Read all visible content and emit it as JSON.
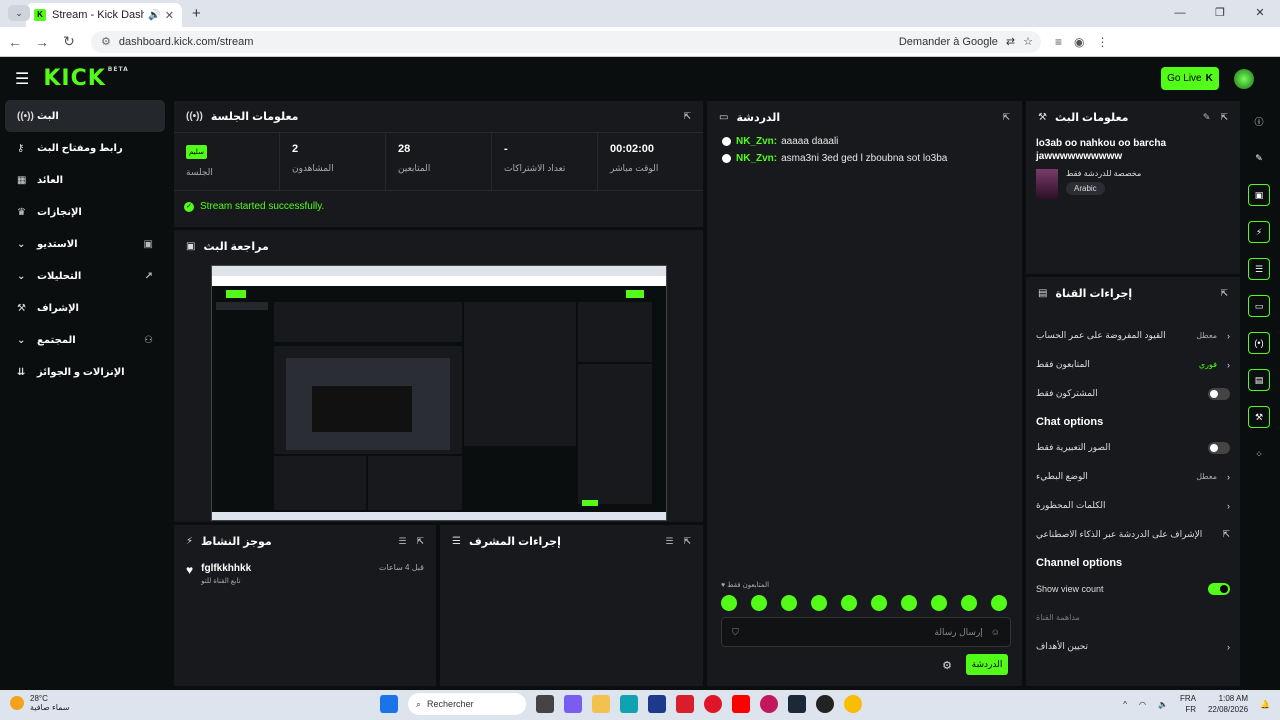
{
  "browser": {
    "tab_title": "Stream - Kick Dashboard",
    "url": "dashboard.kick.com/stream",
    "ask_google": "Demander à Google"
  },
  "header": {
    "logo": "KICK",
    "beta": "BETA",
    "go_live": "Go Live"
  },
  "sidebar": {
    "items": [
      {
        "label": "البث",
        "icon": "broadcast-icon"
      },
      {
        "label": "رابط ومفتاح البث",
        "icon": "key-icon"
      },
      {
        "label": "العائد",
        "icon": "revenue-icon"
      },
      {
        "label": "الإنجازات",
        "icon": "trophy-icon"
      },
      {
        "label": "الاستديو",
        "icon": "studio-icon"
      },
      {
        "label": "التحليلات",
        "icon": "analytics-icon"
      },
      {
        "label": "الإشراف",
        "icon": "moderation-icon"
      },
      {
        "label": "المجتمع",
        "icon": "community-icon"
      },
      {
        "label": "الإنزالات و الجوائز",
        "icon": "drops-icon"
      }
    ]
  },
  "session": {
    "title": "معلومات الجلسة",
    "stats": [
      {
        "value": "سليم",
        "label": "الجلسة"
      },
      {
        "value": "2",
        "label": "المشاهدون"
      },
      {
        "value": "28",
        "label": "المتابعين"
      },
      {
        "value": "-",
        "label": "تعداد الاشتراكات"
      },
      {
        "value": "00:02:00",
        "label": "الوقت مباشر"
      }
    ],
    "status": "Stream started successfully."
  },
  "preview": {
    "title": "مراجعة البث"
  },
  "activity": {
    "title": "موجز النشاط",
    "item_user": "fglfkkhhkk",
    "item_time": "قبل 4 ساعات",
    "item_action": "تابع القناة للتو"
  },
  "mod_actions": {
    "title": "إجراءات المشرف"
  },
  "chat": {
    "title": "الدردشة",
    "messages": [
      {
        "user": "NK_Zvn:",
        "text": "aaaaa daaali"
      },
      {
        "user": "NK_Zvn:",
        "text": "asma3ni 3ed ged l zboubna sot lo3ba"
      }
    ],
    "subs_only": "المتابعون فقط",
    "placeholder": "إرسال رسالة",
    "send": "الدردشة"
  },
  "stream_info": {
    "title": "معلومات البث",
    "stream_title": "lo3ab oo nahkou oo barcha jawwwwwwwwww",
    "category": "مخصصة للدردشة فقط",
    "language": "Arabic"
  },
  "channel_actions": {
    "title": "إجراءات القناة",
    "rows": [
      {
        "label": "القيود المفروضة على عمر الحساب",
        "value": "معطل",
        "kind": "chev"
      },
      {
        "label": "المتابعون فقط",
        "value": "فوري",
        "kind": "chev",
        "green": true
      },
      {
        "label": "المشتركون فقط",
        "value": "",
        "kind": "toggle"
      }
    ],
    "chat_options_title": "Chat options",
    "chat_rows": [
      {
        "label": "الصور التعبيرية فقط",
        "value": "",
        "kind": "toggle"
      },
      {
        "label": "الوضع البطيء",
        "value": "معطل",
        "kind": "chev"
      },
      {
        "label": "الكلمات المحظورة",
        "value": "",
        "kind": "chev"
      },
      {
        "label": "الإشراف على الدردشة عبر الذكاء الاصطناعي",
        "value": "",
        "kind": "ext"
      }
    ],
    "channel_options_title": "Channel options",
    "show_view_count": "Show view count",
    "host_label": "مداهمة القناة",
    "goals_label": "تحيين الأهداف"
  },
  "taskbar": {
    "temp": "28°C",
    "weather": "سماء صافية",
    "search": "Rechercher",
    "lang1": "FRA",
    "lang2": "FR",
    "time": "1:08 AM",
    "date": "22/08/2026"
  }
}
